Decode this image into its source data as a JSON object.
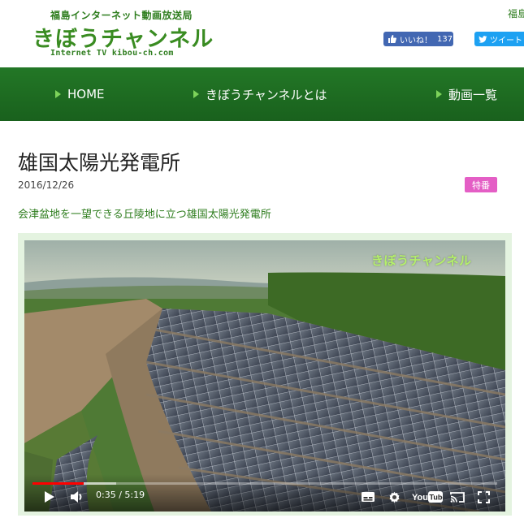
{
  "header": {
    "logo_small": "福島インターネット動画放送局",
    "logo_main": "きぼうチャンネル",
    "logo_sub": "Internet TV  kibou-ch.com",
    "cut_text": "福島",
    "facebook_label": "いいね！",
    "facebook_count": "137",
    "twitter_label": "ツイート"
  },
  "nav": {
    "items": [
      {
        "label": "HOME"
      },
      {
        "label": "きぼうチャンネルとは"
      },
      {
        "label": "動画一覧"
      }
    ]
  },
  "article": {
    "title": "雄国太陽光発電所",
    "date": "2016/12/26",
    "badge": "特番",
    "description": "会津盆地を一望できる丘陵地に立つ雄国太陽光発電所"
  },
  "video": {
    "watermark": "きぼうチャンネル",
    "current_time": "0:35",
    "separator": " / ",
    "duration": "5:19",
    "progress_fraction": 0.11,
    "loaded_fraction": 0.18,
    "icons": [
      "play-icon",
      "volume-icon",
      "subtitles-icon",
      "settings-icon",
      "youtube-logo",
      "cast-icon",
      "fullscreen-icon"
    ],
    "youtube_text": "YouTube"
  },
  "colors": {
    "nav_bg": "#1d6a22",
    "brand_green": "#3a8c22",
    "badge_pink": "#e45ec5",
    "facebook_blue": "#4267b2",
    "twitter_blue": "#1da1f2",
    "progress_red": "#ff0000"
  }
}
